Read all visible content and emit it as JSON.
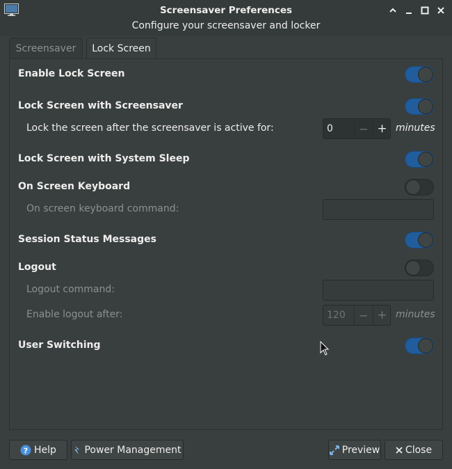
{
  "window": {
    "title": "Screensaver Preferences",
    "subtitle": "Configure your screensaver and locker"
  },
  "tabs": [
    {
      "label": "Screensaver",
      "active": false
    },
    {
      "label": "Lock Screen",
      "active": true
    }
  ],
  "settings": {
    "enable_lock_screen": {
      "label": "Enable Lock Screen",
      "on": true
    },
    "lock_with_screensaver": {
      "label": "Lock Screen with Screensaver",
      "on": true
    },
    "lock_after": {
      "label": "Lock the screen after the screensaver is active for:",
      "value": "0",
      "unit": "minutes"
    },
    "lock_with_sleep": {
      "label": "Lock Screen with System Sleep",
      "on": true
    },
    "osk": {
      "label": "On Screen Keyboard",
      "on": false
    },
    "osk_command": {
      "label": "On screen keyboard command:",
      "value": ""
    },
    "session_status": {
      "label": "Session Status Messages",
      "on": true
    },
    "logout": {
      "label": "Logout",
      "on": false
    },
    "logout_command": {
      "label": "Logout command:",
      "value": ""
    },
    "logout_after": {
      "label": "Enable logout after:",
      "value": "120",
      "unit": "minutes"
    },
    "user_switching": {
      "label": "User Switching",
      "on": true
    }
  },
  "buttons": {
    "help": "Help",
    "power_management": "Power Management",
    "preview": "Preview",
    "close": "Close"
  },
  "colors": {
    "accent": "#215d9c",
    "background": "#393f3f"
  }
}
